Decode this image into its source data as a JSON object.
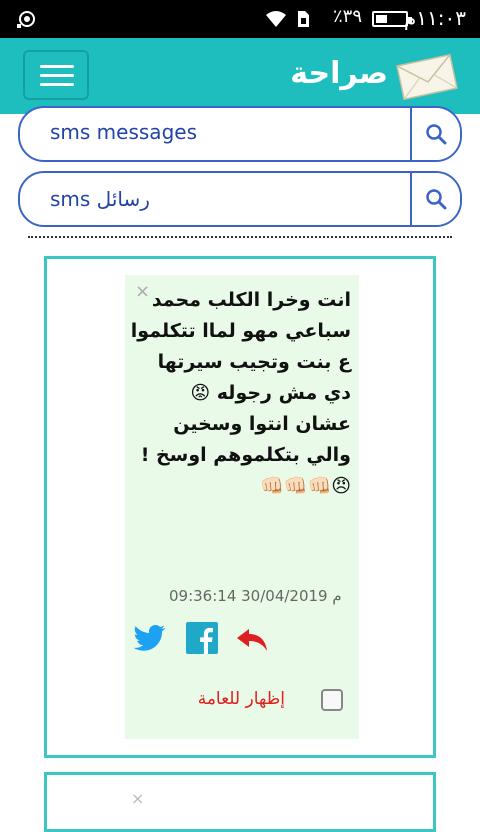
{
  "status_bar": {
    "time": "١١:٠٣م",
    "battery_pct": "٪٣٩",
    "battery_level": 0.39,
    "icons": [
      "record-icon",
      "wifi-icon",
      "sim-icon",
      "battery-icon"
    ]
  },
  "app_bar": {
    "title": "صراحة",
    "logo": "envelope-icon",
    "menu": "menu-icon"
  },
  "search": [
    {
      "value": "sms messages",
      "icon": "search-icon"
    },
    {
      "value": "رسائل sms",
      "icon": "search-icon"
    }
  ],
  "message_card": {
    "text": "انت وخرا الكلب محمد سباعي مهو لماا تتكلموا ع بنت وتجيب سيرتها دي مش رجوله 😡\nعشان انتوا وسخين والي بتكلموهم اوسخ !\n😠👊🏻👊🏻👊🏻",
    "timestamp": "09:36:14 30/04/2019 م",
    "close": "×",
    "public_label": "إظهار للعامة",
    "public_checked": false
  },
  "colors": {
    "accent": "#1fbebe",
    "search_border": "#3c64c8",
    "card_bg": "#e9fbe8",
    "twitter": "#1da1f2",
    "facebook": "#1fa8c8",
    "reply": "#e02020"
  }
}
